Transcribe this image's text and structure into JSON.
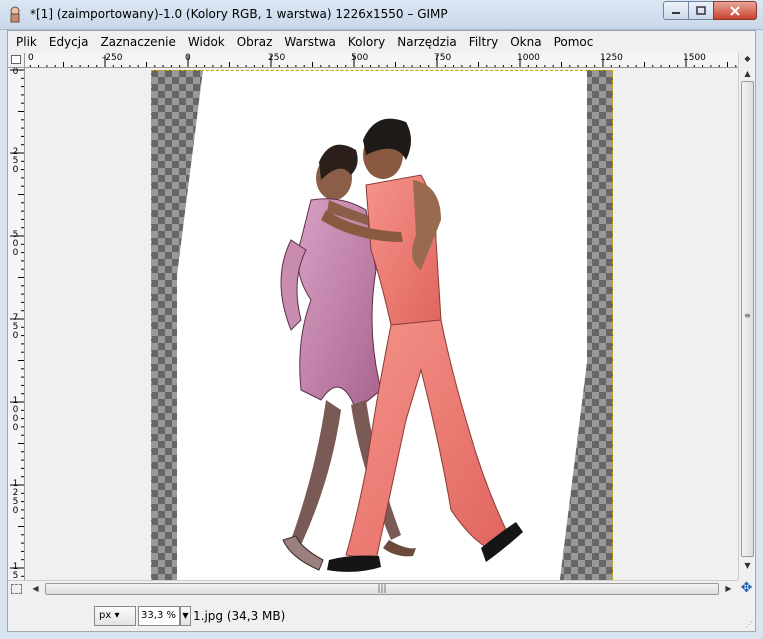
{
  "window": {
    "title": "*[1] (zaimportowany)-1.0 (Kolory RGB, 1 warstwa) 1226x1550 – GIMP"
  },
  "menu": [
    {
      "label": "Plik",
      "name": "menu-plik"
    },
    {
      "label": "Edycja",
      "name": "menu-edycja"
    },
    {
      "label": "Zaznaczenie",
      "name": "menu-zaznaczenie"
    },
    {
      "label": "Widok",
      "name": "menu-widok"
    },
    {
      "label": "Obraz",
      "name": "menu-obraz"
    },
    {
      "label": "Warstwa",
      "name": "menu-warstwa"
    },
    {
      "label": "Kolory",
      "name": "menu-kolory"
    },
    {
      "label": "Narzędzia",
      "name": "menu-narzedzia"
    },
    {
      "label": "Filtry",
      "name": "menu-filtry"
    },
    {
      "label": "Okna",
      "name": "menu-okna"
    },
    {
      "label": "Pomoc",
      "name": "menu-pomoc"
    }
  ],
  "hruler_labels": [
    "0",
    "-250",
    "0",
    "250",
    "500",
    "750",
    "1000",
    "1250",
    "1500"
  ],
  "vruler_labels": [
    "0",
    "250",
    "500",
    "750",
    "1000",
    "1250",
    "15"
  ],
  "status": {
    "unit": "px",
    "zoom": "33,3 %",
    "file_info": "1.jpg (34,3 MB)"
  },
  "icons": {
    "app": "gimp-icon",
    "minimize": "minimize-icon",
    "maximize": "maximize-icon",
    "close": "close-icon",
    "navigate": "navigate-icon",
    "quick_mask": "quick-mask-icon"
  }
}
